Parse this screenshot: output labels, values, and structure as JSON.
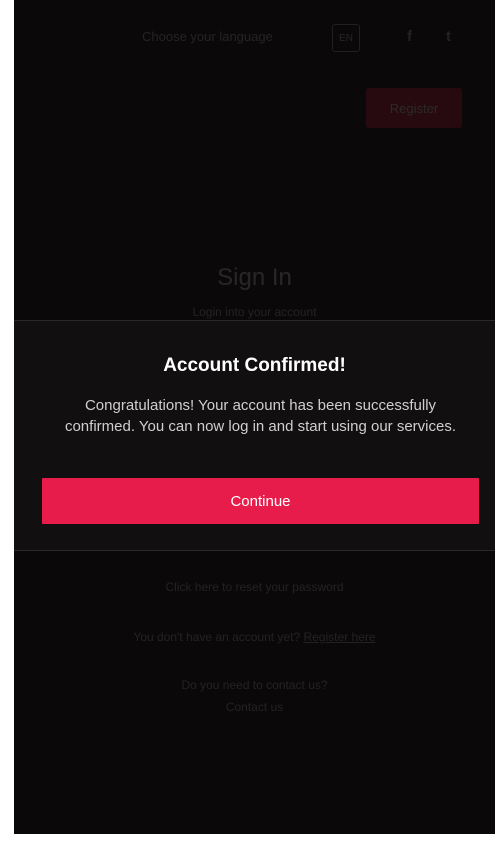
{
  "background": {
    "language_prompt": "Choose your language",
    "language_code": "EN",
    "facebook_icon": "facebook-icon",
    "twitter_icon": "twitter-icon",
    "register_label": "Register",
    "signin_title": "Sign In",
    "signin_subtitle": "Login into your account",
    "forgot_text": "Click here to reset your password",
    "signup_prefix": "You don't have an account yet?",
    "signup_link": "Register here",
    "contact_line": "Do you need to contact us?",
    "contact_link": "Contact us"
  },
  "modal": {
    "title": "Account Confirmed!",
    "message": "Congratulations! Your account has been successfully confirmed. You can now log in and start using our services.",
    "continue_label": "Continue"
  },
  "colors": {
    "accent": "#e81c4a",
    "background": "#0a0808",
    "modal_background": "#110f0f"
  }
}
